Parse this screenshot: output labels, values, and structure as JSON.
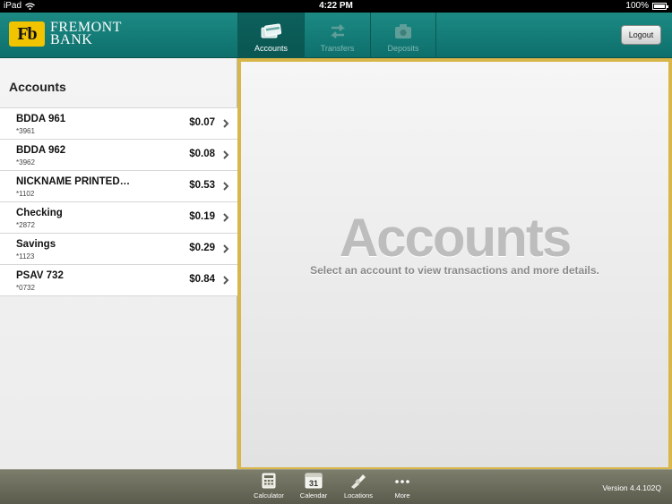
{
  "status_bar": {
    "device": "iPad",
    "time": "4:22 PM",
    "battery": "100%"
  },
  "header": {
    "logo_mark": "Fb",
    "logo_line1": "FREMONT",
    "logo_line2": "BANK",
    "tabs": [
      {
        "label": "Accounts",
        "icon": "accounts-icon",
        "active": true
      },
      {
        "label": "Transfers",
        "icon": "transfers-icon",
        "active": false
      },
      {
        "label": "Deposits",
        "icon": "deposits-icon",
        "active": false
      }
    ],
    "logout_label": "Logout"
  },
  "left_panel": {
    "title": "Accounts",
    "accounts": [
      {
        "name": "BDDA 961",
        "number": "*3961",
        "balance": "$0.07"
      },
      {
        "name": "BDDA 962",
        "number": "*3962",
        "balance": "$0.08"
      },
      {
        "name": "NICKNAME PRINTED…",
        "number": "*1102",
        "balance": "$0.53"
      },
      {
        "name": "Checking",
        "number": "*2872",
        "balance": "$0.19"
      },
      {
        "name": "Savings",
        "number": "*1123",
        "balance": "$0.29"
      },
      {
        "name": "PSAV 732",
        "number": "*0732",
        "balance": "$0.84"
      }
    ]
  },
  "detail": {
    "placeholder_title": "Accounts",
    "placeholder_subtitle": "Select an account to view transactions and more details."
  },
  "toolbar": {
    "items": [
      {
        "label": "Calculator",
        "icon": "calculator-icon"
      },
      {
        "label": "Calendar",
        "icon": "calendar-icon",
        "icon_text": "31"
      },
      {
        "label": "Locations",
        "icon": "locations-icon"
      },
      {
        "label": "More",
        "icon": "more-icon"
      }
    ],
    "version": "Version 4.4.102Q"
  },
  "colors": {
    "header": "#14807b",
    "accent_gold": "#d9b64a",
    "toolbar": "#6b6c5b"
  }
}
